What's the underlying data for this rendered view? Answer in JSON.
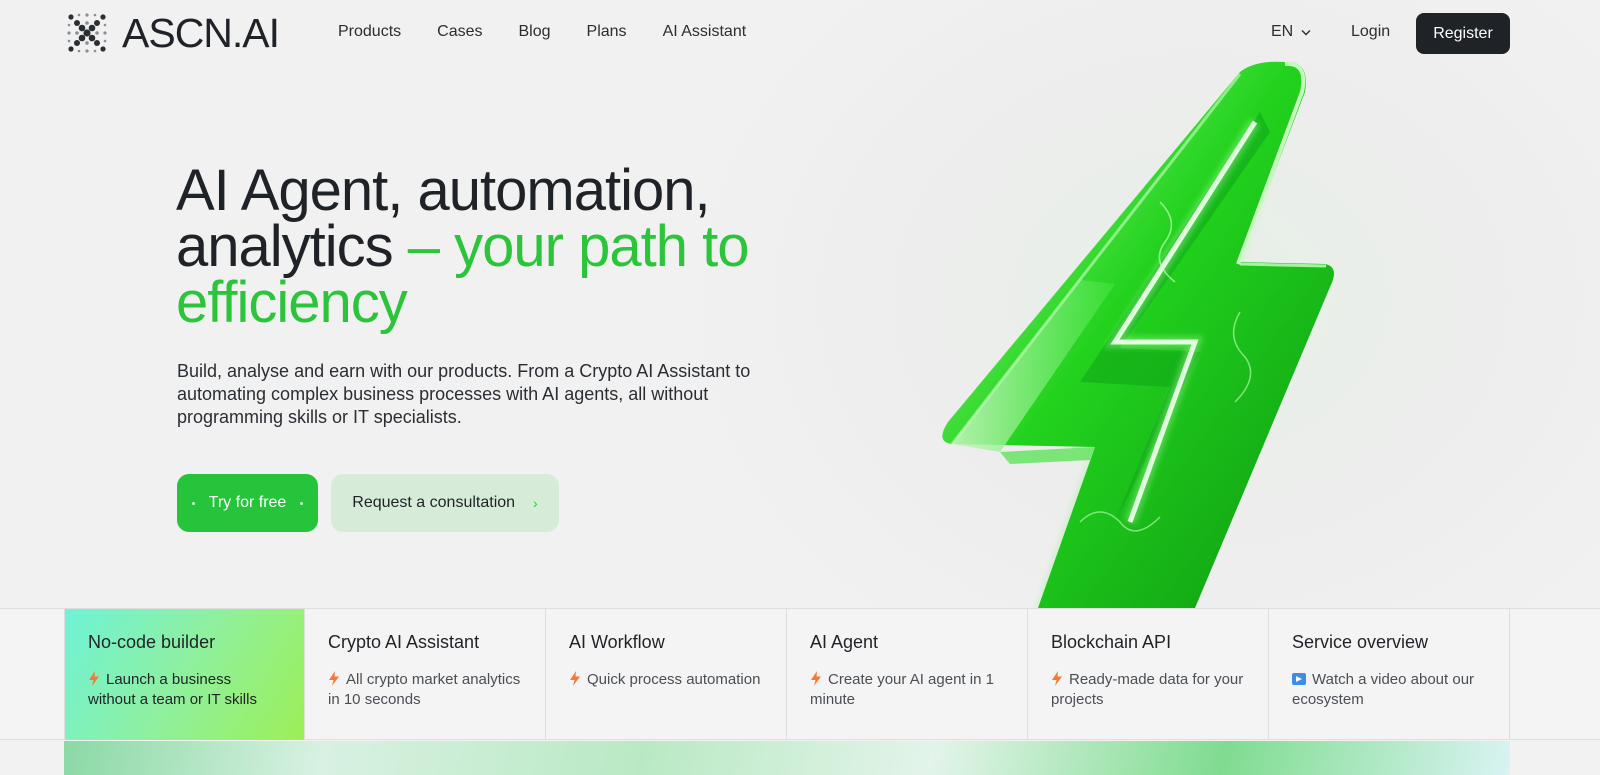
{
  "brand": {
    "name": "ASCN.AI"
  },
  "nav": {
    "links": [
      "Products",
      "Cases",
      "Blog",
      "Plans",
      "AI Assistant"
    ],
    "language": "EN",
    "login": "Login",
    "register": "Register"
  },
  "hero": {
    "title_main": "AI Agent, automation, analytics",
    "title_accent": "– your path to efficiency",
    "subtitle": "Build, analyse and earn with our products. From a Crypto AI Assistant to automating complex business processes with AI agents, all without programming skills or IT specialists.",
    "cta_primary": "Try for free",
    "cta_secondary": "Request a consultation"
  },
  "cards": [
    {
      "title": "No-code builder",
      "desc": "Launch a business without a team or IT skills",
      "icon": "lightning-icon"
    },
    {
      "title": "Crypto AI Assistant",
      "desc": "All crypto market analytics in 10 seconds",
      "icon": "lightning-icon"
    },
    {
      "title": "AI Workflow",
      "desc": "Quick process automation",
      "icon": "lightning-icon"
    },
    {
      "title": "AI Agent",
      "desc": "Create your AI agent in 1 minute",
      "icon": "lightning-icon"
    },
    {
      "title": "Blockchain API",
      "desc": "Ready-made data for your projects",
      "icon": "lightning-icon"
    },
    {
      "title": "Service overview",
      "desc": "Watch a video about our ecosystem",
      "icon": "video-icon"
    }
  ],
  "colors": {
    "accent": "#2bc43a",
    "dark": "#1f2327",
    "card_icon": "#f07a3a"
  }
}
